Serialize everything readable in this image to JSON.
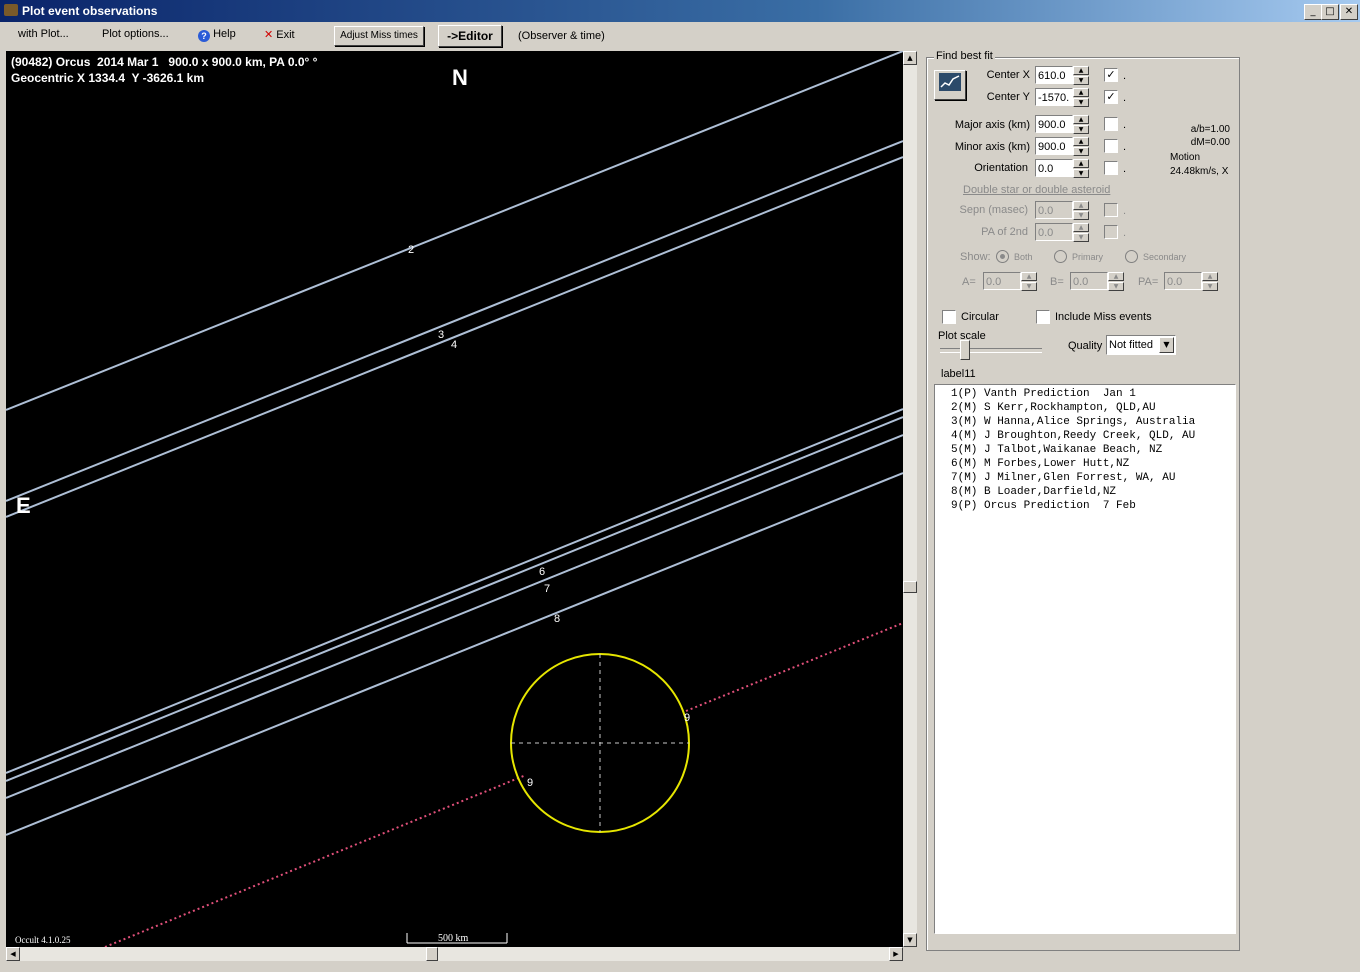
{
  "window": {
    "title": "Plot event observations",
    "minimize_glyph": "_",
    "maximize_glyph": "□",
    "close_glyph": "✕"
  },
  "menu": {
    "with_plot": "with Plot...",
    "plot_options": "Plot options...",
    "help": "Help",
    "exit": "Exit",
    "adjust_miss_times": "Adjust Miss times",
    "editor": "->Editor",
    "observer_time": "(Observer & time)"
  },
  "plot": {
    "header_line1": "(90482) Orcus  2014 Mar 1   900.0 x 900.0 km, PA 0.0° °",
    "header_line2": "Geocentric X 1334.4  Y -3626.1 km",
    "north_label": "N",
    "east_label": "E",
    "version": "Occult 4.1.0.25",
    "scale_label": "500 km",
    "chord_labels": [
      "2",
      "3",
      "4",
      "6",
      "7",
      "8",
      "9",
      "9"
    ],
    "colors": {
      "background": "#000000",
      "chord": "#aebfd6",
      "prediction": "#e0507a",
      "ellipse": "#e6e600"
    }
  },
  "panel": {
    "find_best_fit": "Find best fit",
    "center_x_label": "Center X",
    "center_x_value": "610.0",
    "center_y_label": "Center Y",
    "center_y_value": "-1570.",
    "major_axis_label": "Major axis (km)",
    "major_axis_value": "900.0",
    "minor_axis_label": "Minor axis (km)",
    "minor_axis_value": "900.0",
    "orientation_label": "Orientation",
    "orientation_value": "0.0",
    "ab_ratio": "a/b=1.00",
    "dm": "dM=0.00",
    "motion_label": "Motion",
    "motion_value": "24.48km/s, X",
    "double_star": "Double star  or  double asteroid",
    "sepn_label": "Sepn (masec)",
    "sepn_value": "0.0",
    "pa2_label": "PA of 2nd",
    "pa2_value": "0.0",
    "show_label": "Show:",
    "both": "Both",
    "primary": "Primary",
    "secondary": "Secondary",
    "a_label": "A=",
    "a_value": "0.0",
    "b_label": "B=",
    "b_value": "0.0",
    "pa_label": "PA=",
    "pa_value": "0.0",
    "circular": "Circular",
    "include_miss": "Include Miss events",
    "plot_scale": "Plot scale",
    "quality_label": "Quality",
    "quality_value": "Not fitted",
    "label11": "label11",
    "checkmark": "✓",
    "dot": "."
  },
  "observers": [
    "1(P) Vanth Prediction  Jan 1",
    "2(M) S Kerr,Rockhampton, QLD,AU",
    "3(M) W Hanna,Alice Springs, Australia",
    "4(M) J Broughton,Reedy Creek, QLD, AU",
    "5(M) J Talbot,Waikanae Beach, NZ",
    "6(M) M Forbes,Lower Hutt,NZ",
    "7(M) J Milner,Glen Forrest, WA, AU",
    "8(M) B Loader,Darfield,NZ",
    "9(P) Orcus Prediction  7 Feb"
  ]
}
